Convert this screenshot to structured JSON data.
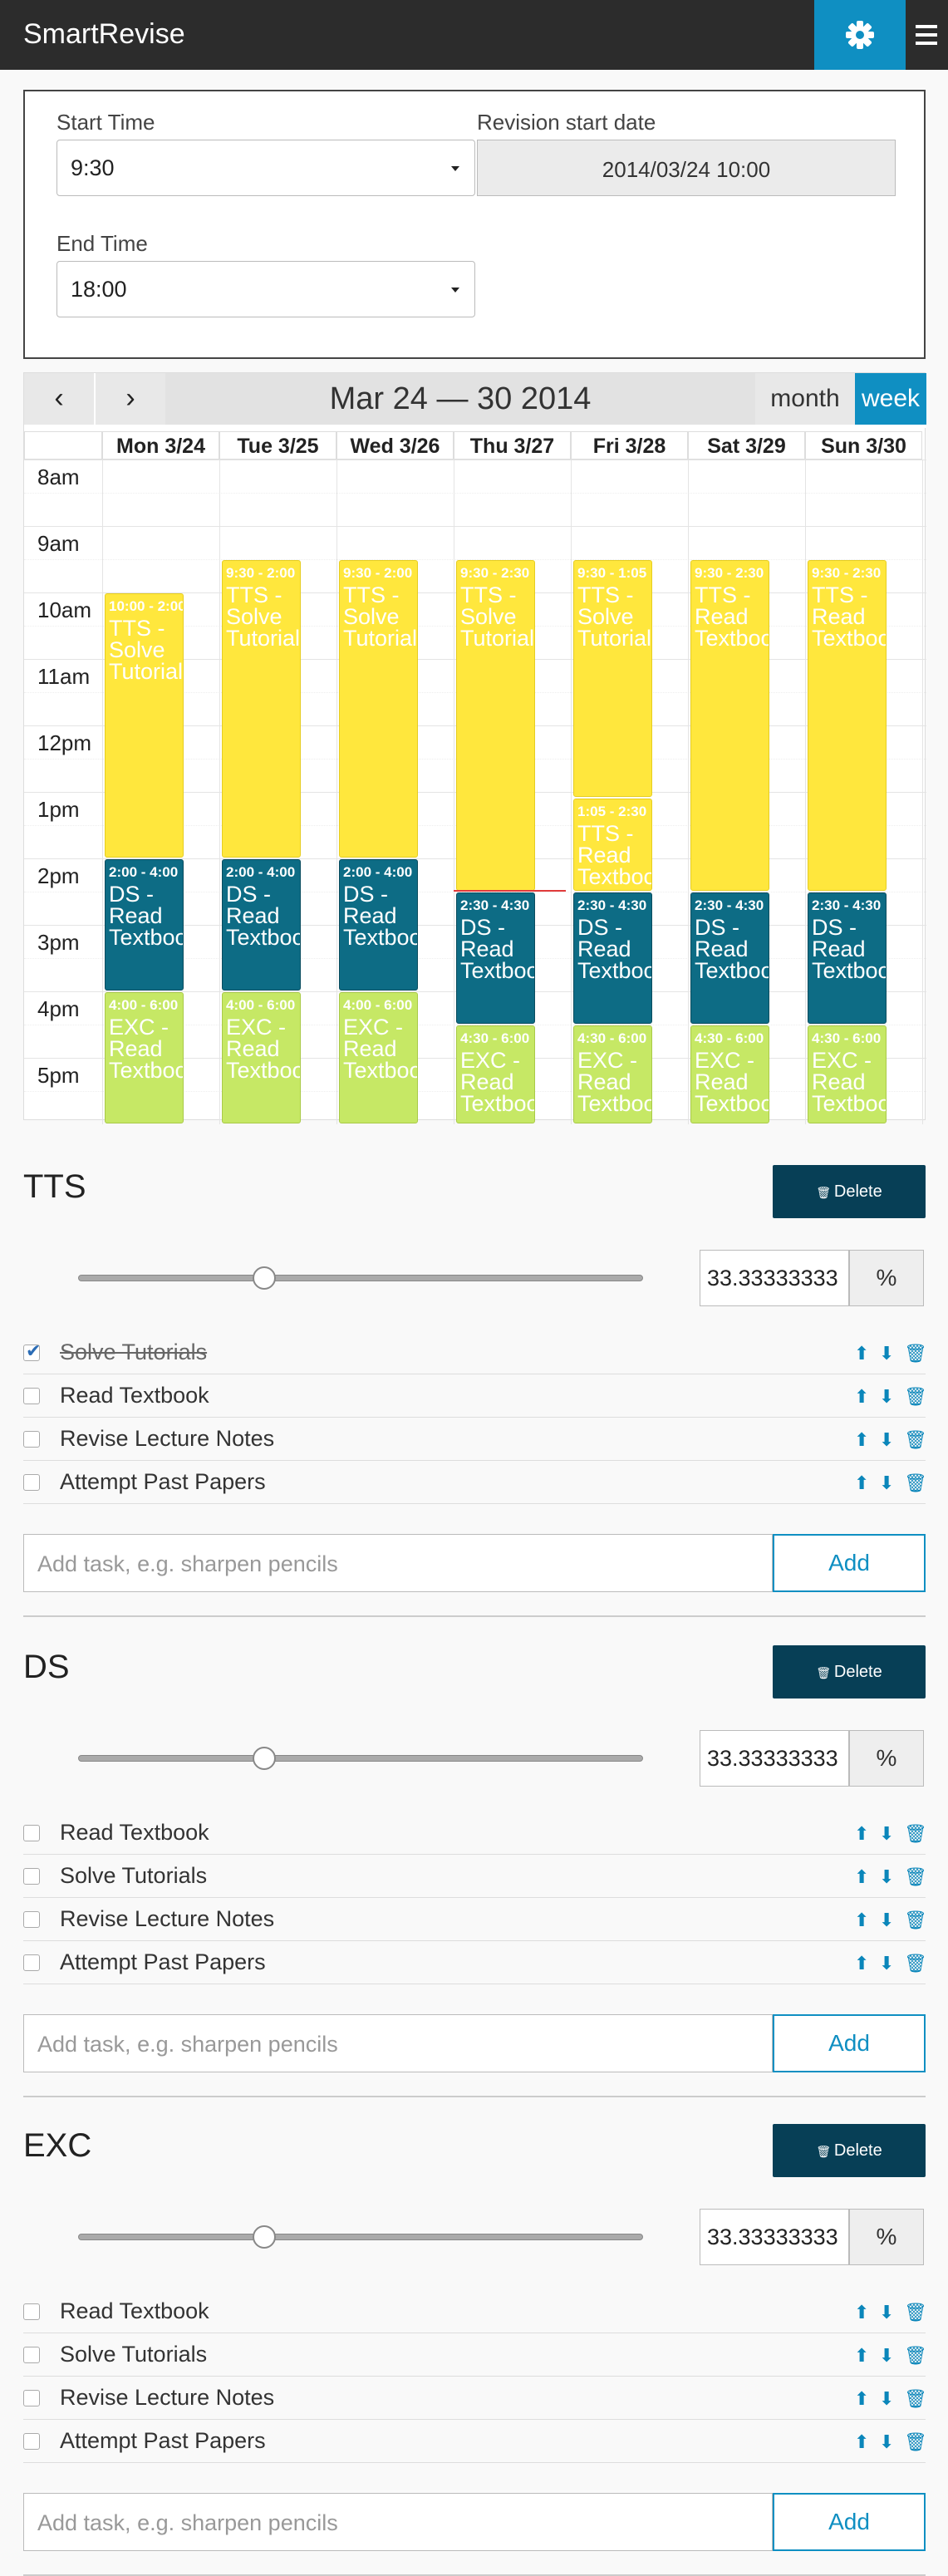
{
  "app": {
    "title": "SmartRevise"
  },
  "settings": {
    "start_time_label": "Start Time",
    "start_time": "9:30",
    "end_time_label": "End Time",
    "end_time": "18:00",
    "revision_start_label": "Revision start date",
    "revision_start": "2014/03/24 10:00"
  },
  "calendar": {
    "prev": "‹",
    "next": "›",
    "title": "Mar 24 — 30 2014",
    "view_month": "month",
    "view_week": "week",
    "days": [
      "Mon 3/24",
      "Tue 3/25",
      "Wed 3/26",
      "Thu 3/27",
      "Fri 3/28",
      "Sat 3/29",
      "Sun 3/30"
    ],
    "hours": [
      "8am",
      "9am",
      "10am",
      "11am",
      "12pm",
      "1pm",
      "2pm",
      "3pm",
      "4pm",
      "5pm"
    ],
    "events": [
      {
        "day": 0,
        "time": "10:00 - 2:00",
        "title": "TTS - Solve Tutorials",
        "color": "y",
        "start": "10:00",
        "end": "14:00"
      },
      {
        "day": 0,
        "time": "2:00 - 4:00",
        "title": "DS - Read Textbook",
        "color": "b",
        "start": "14:00",
        "end": "16:00"
      },
      {
        "day": 0,
        "time": "4:00 - 6:00",
        "title": "EXC - Read Textbook",
        "color": "g",
        "start": "16:00",
        "end": "18:00"
      },
      {
        "day": 1,
        "time": "9:30 - 2:00",
        "title": "TTS - Solve Tutorials",
        "color": "y",
        "start": "09:30",
        "end": "14:00"
      },
      {
        "day": 1,
        "time": "2:00 - 4:00",
        "title": "DS - Read Textbook",
        "color": "b",
        "start": "14:00",
        "end": "16:00"
      },
      {
        "day": 1,
        "time": "4:00 - 6:00",
        "title": "EXC - Read Textbook",
        "color": "g",
        "start": "16:00",
        "end": "18:00"
      },
      {
        "day": 2,
        "time": "9:30 - 2:00",
        "title": "TTS - Solve Tutorials",
        "color": "y",
        "start": "09:30",
        "end": "14:00"
      },
      {
        "day": 2,
        "time": "2:00 - 4:00",
        "title": "DS - Read Textbook",
        "color": "b",
        "start": "14:00",
        "end": "16:00"
      },
      {
        "day": 2,
        "time": "4:00 - 6:00",
        "title": "EXC - Read Textbook",
        "color": "g",
        "start": "16:00",
        "end": "18:00"
      },
      {
        "day": 3,
        "time": "9:30 - 2:30",
        "title": "TTS - Solve Tutorials",
        "color": "y",
        "start": "09:30",
        "end": "14:30"
      },
      {
        "day": 3,
        "time": "2:30 - 4:30",
        "title": "DS - Read Textbook",
        "color": "b",
        "start": "14:30",
        "end": "16:30"
      },
      {
        "day": 3,
        "time": "4:30 - 6:00",
        "title": "EXC - Read Textbook",
        "color": "g",
        "start": "16:30",
        "end": "18:00"
      },
      {
        "day": 4,
        "time": "9:30 - 1:05",
        "title": "TTS - Solve Tutorials",
        "color": "y",
        "start": "09:30",
        "end": "13:05"
      },
      {
        "day": 4,
        "time": "1:05 - 2:30",
        "title": "TTS - Read Textbook",
        "color": "y",
        "start": "13:05",
        "end": "14:30"
      },
      {
        "day": 4,
        "time": "2:30 - 4:30",
        "title": "DS - Read Textbook",
        "color": "b",
        "start": "14:30",
        "end": "16:30"
      },
      {
        "day": 4,
        "time": "4:30 - 6:00",
        "title": "EXC - Read Textbook",
        "color": "g",
        "start": "16:30",
        "end": "18:00"
      },
      {
        "day": 5,
        "time": "9:30 - 2:30",
        "title": "TTS - Read Textbook",
        "color": "y",
        "start": "09:30",
        "end": "14:30"
      },
      {
        "day": 5,
        "time": "2:30 - 4:30",
        "title": "DS - Read Textbook",
        "color": "b",
        "start": "14:30",
        "end": "16:30"
      },
      {
        "day": 5,
        "time": "4:30 - 6:00",
        "title": "EXC - Read Textbook",
        "color": "g",
        "start": "16:30",
        "end": "18:00"
      },
      {
        "day": 6,
        "time": "9:30 - 2:30",
        "title": "TTS - Read Textbook",
        "color": "y",
        "start": "09:30",
        "end": "14:30"
      },
      {
        "day": 6,
        "time": "2:30 - 4:30",
        "title": "DS - Read Textbook",
        "color": "b",
        "start": "14:30",
        "end": "16:30"
      },
      {
        "day": 6,
        "time": "4:30 - 6:00",
        "title": "EXC - Read Textbook",
        "color": "g",
        "start": "16:30",
        "end": "18:00"
      }
    ]
  },
  "subjects": [
    {
      "name": "TTS",
      "delete_label": "Delete",
      "percent": "33.33333333",
      "percent_unit": "%",
      "slider_value": 0.33,
      "tasks": [
        {
          "label": "Solve Tutorials",
          "done": true
        },
        {
          "label": "Read Textbook",
          "done": false
        },
        {
          "label": "Revise Lecture Notes",
          "done": false
        },
        {
          "label": "Attempt Past Papers",
          "done": false
        }
      ],
      "add_placeholder": "Add task, e.g. sharpen pencils",
      "add_label": "Add"
    },
    {
      "name": "DS",
      "delete_label": "Delete",
      "percent": "33.33333333",
      "percent_unit": "%",
      "slider_value": 0.33,
      "tasks": [
        {
          "label": "Read Textbook",
          "done": false
        },
        {
          "label": "Solve Tutorials",
          "done": false
        },
        {
          "label": "Revise Lecture Notes",
          "done": false
        },
        {
          "label": "Attempt Past Papers",
          "done": false
        }
      ],
      "add_placeholder": "Add task, e.g. sharpen pencils",
      "add_label": "Add"
    },
    {
      "name": "EXC",
      "delete_label": "Delete",
      "percent": "33.33333333",
      "percent_unit": "%",
      "slider_value": 0.33,
      "tasks": [
        {
          "label": "Read Textbook",
          "done": false
        },
        {
          "label": "Solve Tutorials",
          "done": false
        },
        {
          "label": "Revise Lecture Notes",
          "done": false
        },
        {
          "label": "Attempt Past Papers",
          "done": false
        }
      ],
      "add_placeholder": "Add task, e.g. sharpen pencils",
      "add_label": "Add"
    }
  ]
}
